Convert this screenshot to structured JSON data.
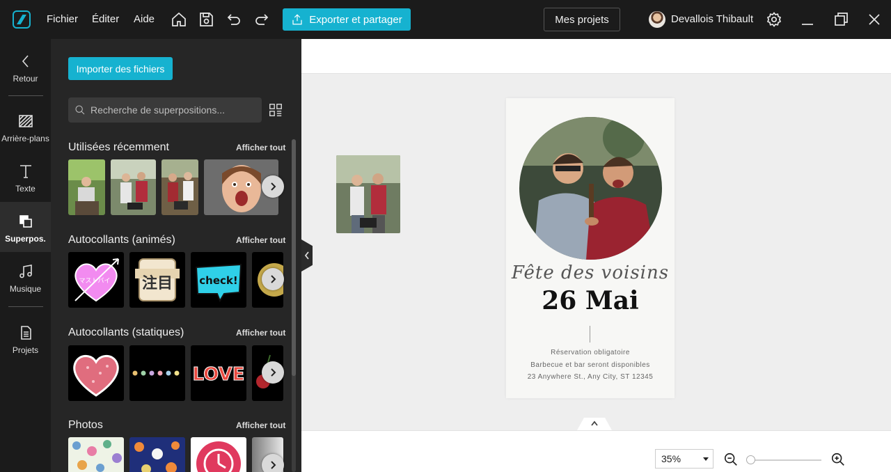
{
  "titlebar": {
    "menu": [
      "Fichier",
      "Éditer",
      "Aide"
    ],
    "export_label": "Exporter et partager",
    "projects_label": "Mes projets",
    "user_name": "Devallois Thibault"
  },
  "nav": {
    "items": [
      {
        "label": "Retour",
        "icon": "back-arrow-icon"
      },
      {
        "label": "Arrière-plans",
        "icon": "backgrounds-icon"
      },
      {
        "label": "Texte",
        "icon": "text-icon"
      },
      {
        "label": "Superpos.",
        "icon": "overlay-icon",
        "active": true
      },
      {
        "label": "Musique",
        "icon": "music-icon"
      },
      {
        "label": "Projets",
        "icon": "document-icon"
      }
    ]
  },
  "panel": {
    "import_label": "Importer des fichiers",
    "search_placeholder": "Recherche de superpositions...",
    "sections": [
      {
        "title": "Utilisées récemment",
        "link": "Afficher tout"
      },
      {
        "title": "Autocollants (animés)",
        "link": "Afficher tout"
      },
      {
        "title": "Autocollants (statiques)",
        "link": "Afficher tout"
      },
      {
        "title": "Photos",
        "link": "Afficher tout"
      }
    ],
    "sticker_texts": {
      "japanese": "マストバイ",
      "kanji": "注目",
      "check": "check!",
      "love": "LOVE"
    }
  },
  "poster": {
    "script_title": "Fête des voisins",
    "date": "26 Mai",
    "line1": "Réservation obligatoire",
    "line2": "Barbecue et bar seront disponibles",
    "line3": "23 Anywhere St., Any City, ST 12345"
  },
  "zoom": {
    "value": "35%",
    "level_percent": 0
  },
  "colors": {
    "accent": "#16b2d0",
    "panel": "#262626",
    "titlebar": "#1b1b1b",
    "canvas": "#eeeeee"
  }
}
